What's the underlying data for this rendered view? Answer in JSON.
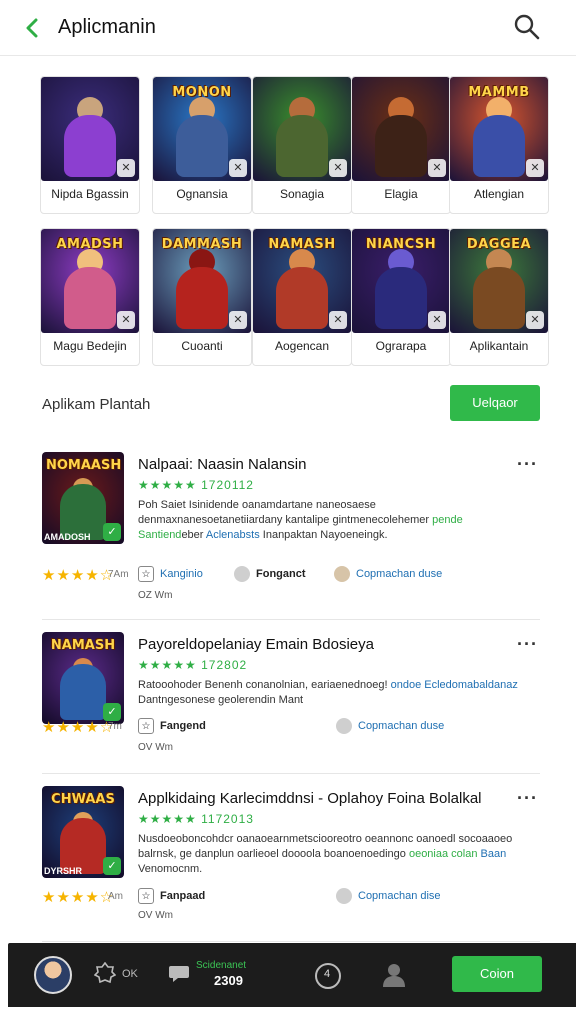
{
  "header": {
    "title": "Aplicmanin",
    "back_icon": "chevron-left-icon",
    "search_icon": "search-icon",
    "accent": "#2fae45"
  },
  "grid": {
    "tiles": [
      {
        "logo": "",
        "label": "Nipda Bgassin",
        "bg": "#3b2d7c",
        "fig": "#8c3fd0",
        "head": "#c9a47d"
      },
      {
        "logo": "MONON",
        "label": "Ognansia",
        "bg": "#2a78c7",
        "fig": "#3d5d9a",
        "head": "#d7a06b"
      },
      {
        "logo": "",
        "label": "Sonagia",
        "bg": "#3a8f2c",
        "fig": "#4c6630",
        "head": "#b56c3c"
      },
      {
        "logo": "",
        "label": "Elagia",
        "bg": "#6b2f14",
        "fig": "#3d2217",
        "head": "#c56b33"
      },
      {
        "logo": "MAMMB",
        "label": "Atlengian",
        "bg": "#d8562e",
        "fig": "#3a4fa8",
        "head": "#f2b06a"
      },
      {
        "logo": "AMADSH",
        "label": "Magu Bedejin",
        "bg": "#8e3cc4",
        "fig": "#d15c8b",
        "head": "#f0c07d"
      },
      {
        "logo": "DAMMASH",
        "label": "Cuoanti",
        "bg": "#6c9fbd",
        "fig": "#b5231e",
        "head": "#8a1613"
      },
      {
        "logo": "NAMASH",
        "label": "Aogencan",
        "bg": "#2b4e7f",
        "fig": "#b13a28",
        "head": "#d8894c"
      },
      {
        "logo": "NIANCSH",
        "label": "Ograrapa",
        "bg": "#3a1e6a",
        "fig": "#2a2a7c",
        "head": "#6a5bd1"
      },
      {
        "logo": "DAGGEA",
        "label": "Aplikantain",
        "bg": "#3d7a3a",
        "fig": "#7a4a22",
        "head": "#c48752"
      }
    ]
  },
  "section": {
    "title": "Aplikam Plantah",
    "button_label": "Uelqaor"
  },
  "apps": [
    {
      "title": "Nalpaai: Naasin Nalansin",
      "rating_text": "★★★★★ 1720112",
      "desc_plain": "Poh Saiet Isinidende oanamdartane naneosaese denmaxnanesoetanetiiardany kantalipe gintmenecolehemer ",
      "desc_green": "pende Santiend",
      "desc_plain2": "eber ",
      "desc_blue": "Aclenabsts",
      "desc_plain3": " Inanpaktan Nayoeneingk.",
      "logo": "NOMAASH",
      "logo_bottom": "AMADOSH",
      "icon_bg": "#6b1a1a",
      "fig": "#2c6f3a",
      "head": "#d69a54",
      "stars_count": 4,
      "size": "7Am",
      "meta1": "Kanginio",
      "meta2": "Fonganct",
      "meta3": "Copmachan duse",
      "subsize": "OZ Wm"
    },
    {
      "title": "Payoreldopelaniay Emain Bdosieya",
      "rating_text": "★★★★★ 172802",
      "desc_plain": "Ratooohoder Benenh conanolnian, eariaenednoeg! ",
      "desc_green": "",
      "desc_plain2": "",
      "desc_blue": "ondoe Ecledomabaldanaz",
      "desc_plain3": " Dantngesonese geolerendin Mant",
      "logo": "NAMASH",
      "logo_bottom": "",
      "icon_bg": "#5b2b8a",
      "fig": "#2c5fa8",
      "head": "#d8894c",
      "stars_count": 4,
      "size": "7m",
      "meta1": "Fangend",
      "meta2": "Copmachan duse",
      "meta3": "",
      "subsize": "OV Wm"
    },
    {
      "title": "Applkidaing Karlecimddnsi - Oplahoy Foina Bolalkal",
      "rating_text": "★★★★★ 1172013",
      "desc_plain": "Nusdoeoboncohdcr oanaoearnmetsciooreotro oeannonc oanoedl socoaaoeo balrnsk, ge danplun oarlieoel doooola boanoenoedingo ",
      "desc_green": "oeoniaa colan",
      "desc_plain2": " ",
      "desc_blue": "Baan",
      "desc_plain3": " Venomocnm.",
      "logo": "CHWAAS",
      "logo_bottom": "DYRSHR",
      "icon_bg": "#1e3f7a",
      "fig": "#b52a24",
      "head": "#e0a05a",
      "stars_count": 4,
      "size": "Am",
      "meta1": "Fanpaad",
      "meta2": "Copmachan dise",
      "meta3": "",
      "subsize": "OV Wm"
    }
  ],
  "bottom_nav": {
    "avatar_icon": "avatar-icon",
    "settings_text": "OK",
    "chat_green": "Scidenanet",
    "chat_count": "2309",
    "notif_count": "4",
    "profile_icon": "person-icon",
    "button_label": "Coion"
  }
}
